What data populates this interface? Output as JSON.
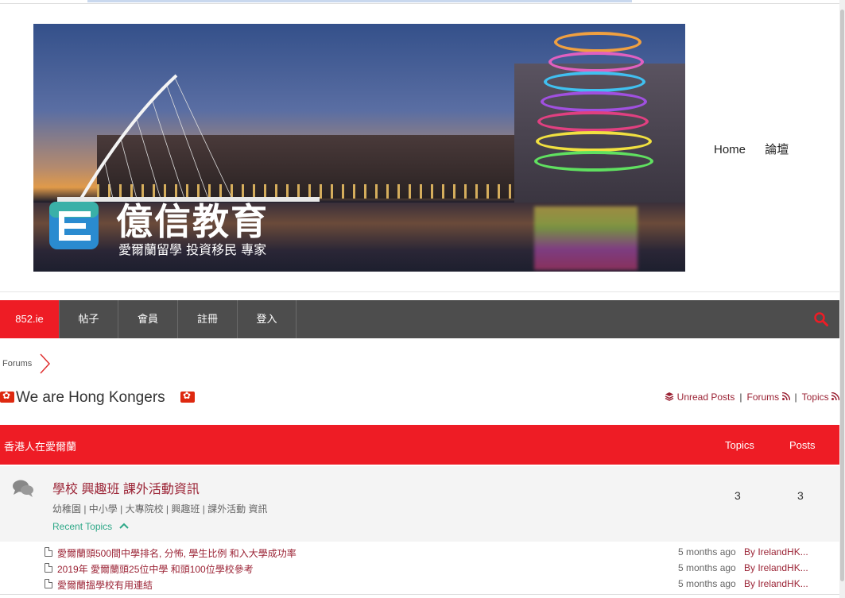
{
  "banner": {
    "logo_title": "億信教育",
    "logo_sub": "愛爾蘭留學 投資移民 專家"
  },
  "top_nav": [
    "Home",
    "論壇"
  ],
  "navbar": {
    "items": [
      "852.ie",
      "帖子",
      "會員",
      "註冊",
      "登入"
    ],
    "accent": "#ee1c25"
  },
  "breadcrumb": "Forums",
  "page_title": "We are Hong Kongers",
  "quick_links": {
    "unread": "Unread Posts",
    "forums": "Forums",
    "topics": "Topics"
  },
  "category": {
    "name": "香港人在愛爾蘭",
    "col_topics": "Topics",
    "col_posts": "Posts"
  },
  "forum": {
    "name": "學校 興趣班 課外活動資訊",
    "description": "幼稚園 | 中小學 | 大專院校 | 興趣班 | 課外活動 資訊",
    "recent_label": "Recent Topics",
    "topics": "3",
    "posts": "3"
  },
  "recent_topics": [
    {
      "title": "愛爾蘭頭500間中學排名, 分怖, 學生比例 和入大學成功率",
      "ago": "5 months ago",
      "by": "By IrelandHK..."
    },
    {
      "title": "2019年 愛爾蘭頭25位中學 和頭100位學校參考",
      "ago": "5 months ago",
      "by": "By IrelandHK..."
    },
    {
      "title": "愛爾蘭搵學校有用連結",
      "ago": "5 months ago",
      "by": "By IrelandHK..."
    }
  ]
}
